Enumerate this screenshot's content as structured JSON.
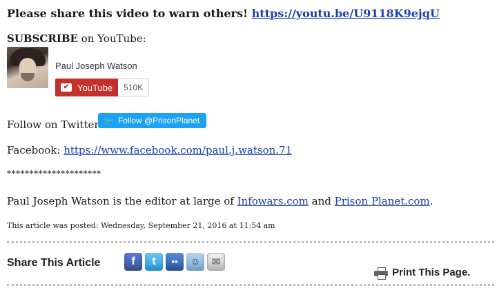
{
  "share": {
    "text": "Please share this video to warn others!",
    "link": "https://youtu.be/U9118K9ejqU"
  },
  "subscribe": {
    "bold": "SUBSCRIBE",
    "rest": " on YouTube:"
  },
  "youtube": {
    "channel_name": "Paul Joseph Watson",
    "button_label": "YouTube",
    "subscriber_count": "510K"
  },
  "twitter": {
    "label": "Follow on Twitter:",
    "button_label": "Follow @PrisonPlanet"
  },
  "facebook": {
    "label": "Facebook:",
    "link": "https://www.facebook.com/paul.j.watson.71"
  },
  "separator": "*********************",
  "bio": {
    "prefix": "Paul Joseph Watson is the editor at large of ",
    "link1": "Infowars.com",
    "middle": " and ",
    "link2": "Prison Planet.com",
    "suffix": "."
  },
  "posted": "This article was posted: Wednesday, September 21, 2016 at 11:54 am",
  "share_article": {
    "title": "Share This Article",
    "icons": [
      "facebook-icon",
      "twitter-icon",
      "delicious-icon",
      "reddit-icon",
      "email-icon"
    ]
  },
  "print": {
    "label": "Print This Page."
  }
}
